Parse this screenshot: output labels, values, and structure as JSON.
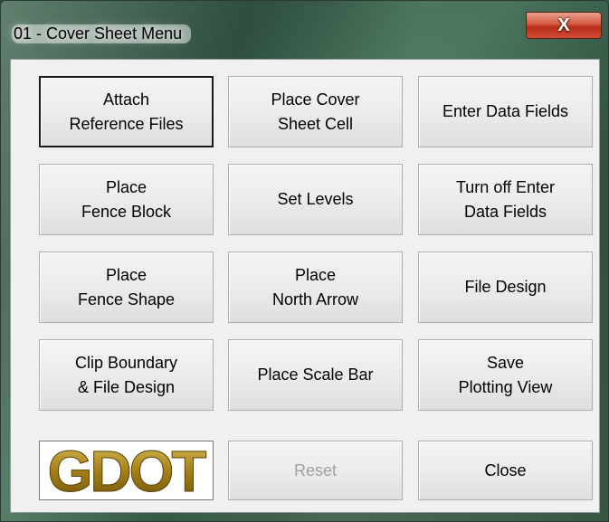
{
  "window": {
    "title": "01 - Cover Sheet Menu",
    "close_glyph": "X"
  },
  "buttons": {
    "attach_reference_files": "Attach\nReference Files",
    "place_cover_sheet_cell": "Place Cover\nSheet Cell",
    "enter_data_fields": "Enter Data Fields",
    "place_fence_block": "Place\nFence Block",
    "set_levels": "Set Levels",
    "turn_off_enter_data_fields": "Turn off Enter\nData Fields",
    "place_fence_shape": "Place\nFence Shape",
    "place_north_arrow": "Place\nNorth Arrow",
    "file_design": "File Design",
    "clip_boundary_file_design": "Clip Boundary\n& File Design",
    "place_scale_bar": "Place Scale Bar",
    "save_plotting_view": "Save\nPlotting View",
    "reset": "Reset",
    "close": "Close"
  },
  "logo": {
    "text": "GDOT",
    "color": "#b08a1e"
  }
}
